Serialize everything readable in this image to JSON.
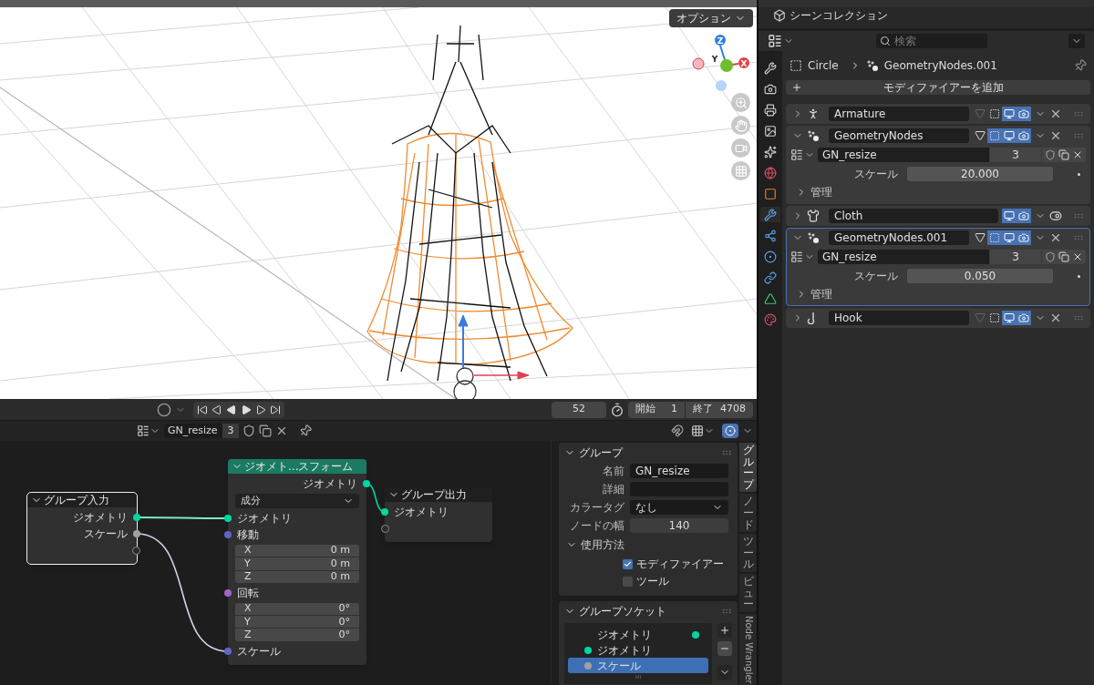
{
  "viewport": {
    "options_button": "オプション",
    "gizmo_axes": [
      {
        "label": "Z",
        "color": "#2f7fe0"
      },
      {
        "label": "Y",
        "color": "#6cbf2a"
      },
      {
        "label": "X",
        "color": "#e0404a"
      }
    ]
  },
  "timeline": {
    "frame": "52",
    "start_label": "開始",
    "start": "1",
    "end_label": "終了",
    "end": "4708"
  },
  "node_header": {
    "node_group": "GN_resize",
    "users": "3"
  },
  "nodes": [
    {
      "kind": "group_input",
      "title": "グループ入力",
      "selected": true,
      "outputs": [
        {
          "kind": "socket",
          "label": "ジオメトリ",
          "color": "#00d6a3"
        },
        {
          "kind": "socket",
          "label": "スケール",
          "color": "#a1a1a1"
        },
        {
          "kind": "empty"
        }
      ]
    },
    {
      "kind": "transform",
      "title": "ジオメト...スフォーム",
      "selected": false,
      "outputs": [
        {
          "kind": "socket",
          "label": "ジオメトリ",
          "color": "#00d6a3"
        }
      ],
      "mode": "成分",
      "inputs": [
        {
          "kind": "socket",
          "label": "ジオメトリ",
          "color": "#00d6a3"
        },
        {
          "kind": "vector",
          "label": "移動",
          "color": "#6363c7",
          "fields": [
            {
              "axis": "X",
              "value": "0 m"
            },
            {
              "axis": "Y",
              "value": "0 m"
            },
            {
              "axis": "Z",
              "value": "0 m"
            }
          ]
        },
        {
          "kind": "vector",
          "label": "回転",
          "color": "#a363c7",
          "fields": [
            {
              "axis": "X",
              "value": "0°"
            },
            {
              "axis": "Y",
              "value": "0°"
            },
            {
              "axis": "Z",
              "value": "0°"
            }
          ]
        },
        {
          "kind": "socket",
          "label": "スケール",
          "color": "#6363c7"
        }
      ]
    },
    {
      "kind": "group_output",
      "title": "グループ出力",
      "selected": false,
      "inputs": [
        {
          "kind": "socket",
          "label": "ジオメトリ",
          "color": "#00d6a3"
        },
        {
          "kind": "empty"
        }
      ]
    }
  ],
  "sidebar": {
    "group_panel": {
      "title": "グループ",
      "expanded": true,
      "fields": [
        {
          "kind": "text",
          "label": "名前",
          "value": "GN_resize"
        },
        {
          "kind": "text",
          "label": "詳細"
        },
        {
          "kind": "dropdown",
          "label": "カラータグ",
          "value": "なし"
        },
        {
          "kind": "number",
          "label": "ノードの幅",
          "value": "140"
        }
      ],
      "usage": {
        "title": "使用方法",
        "expanded": true,
        "options": [
          {
            "label": "モディファイアー",
            "checked": true
          },
          {
            "label": "ツール",
            "checked": false
          }
        ]
      }
    },
    "socket_panel": {
      "title": "グループソケット",
      "expanded": true,
      "items": [
        {
          "kind": "output",
          "label": "ジオメトリ",
          "color": "#00d6a3",
          "selected": false
        },
        {
          "kind": "input",
          "label": "ジオメトリ",
          "color": "#00d6a3",
          "selected": false
        },
        {
          "kind": "input",
          "label": "スケール",
          "color": "#a1a1a1",
          "selected": true
        }
      ]
    },
    "tabs": [
      {
        "label": "グループ",
        "selected": true
      },
      {
        "label": "ノード",
        "selected": false
      },
      {
        "label": "ツール",
        "selected": false
      },
      {
        "label": "ビュー",
        "selected": false
      },
      {
        "label": "Node Wrangler",
        "selected": false
      }
    ]
  },
  "outliner": {
    "items": [
      {
        "label": "シーンコレクション"
      }
    ]
  },
  "properties": {
    "search_placeholder": "検索",
    "tabs": [
      {
        "selected": false
      },
      {
        "selected": false
      },
      {
        "selected": false
      },
      {
        "selected": false
      },
      {
        "selected": false
      },
      {
        "selected": false
      },
      {
        "selected": false
      },
      {
        "selected": true
      },
      {
        "selected": false
      },
      {
        "selected": false
      },
      {
        "selected": false
      },
      {
        "selected": false
      },
      {
        "selected": false
      }
    ],
    "breadcrumb": {
      "object": "Circle",
      "modifier": "GeometryNodes.001"
    },
    "add_button": "モディファイアーを追加",
    "modifiers": [
      {
        "kind": "armature",
        "name": "Armature",
        "expanded": false,
        "selected": false,
        "edit_mode": false,
        "show_viewport": true,
        "show_render": true
      },
      {
        "kind": "geometry_nodes",
        "name": "GeometryNodes",
        "expanded": true,
        "selected": false,
        "edit_mode": true,
        "show_viewport": true,
        "show_render": true,
        "node_group": "GN_resize",
        "users": "3",
        "inputs": [
          {
            "label": "スケール",
            "value": "20.000"
          }
        ],
        "subpanel": "管理"
      },
      {
        "kind": "cloth",
        "name": "Cloth",
        "expanded": false,
        "selected": false,
        "show_viewport": true,
        "show_render": true
      },
      {
        "kind": "geometry_nodes",
        "name": "GeometryNodes.001",
        "expanded": true,
        "selected": true,
        "edit_mode": true,
        "show_viewport": true,
        "show_render": true,
        "node_group": "GN_resize",
        "users": "3",
        "inputs": [
          {
            "label": "スケール",
            "value": "0.050"
          }
        ],
        "subpanel": "管理"
      },
      {
        "kind": "hook",
        "name": "Hook",
        "expanded": false,
        "selected": false,
        "edit_mode": false,
        "show_viewport": true,
        "show_render": true
      }
    ]
  }
}
